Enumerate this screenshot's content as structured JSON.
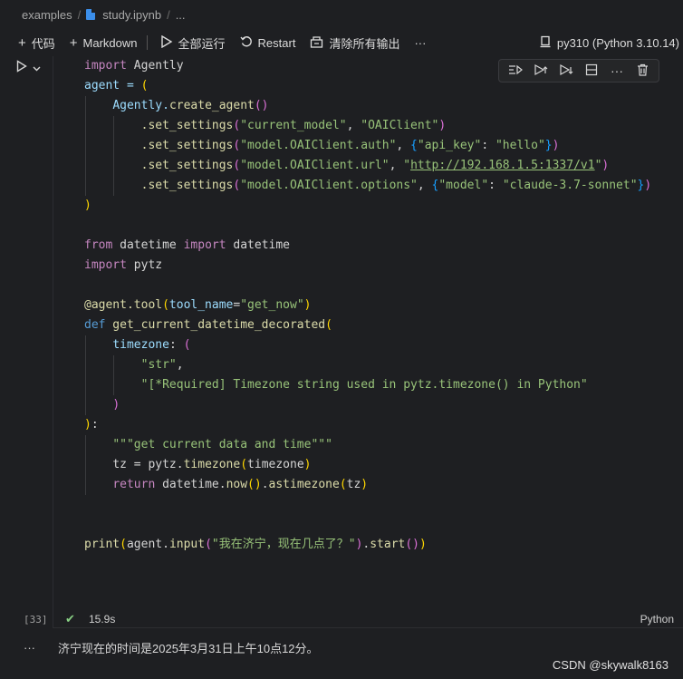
{
  "breadcrumb": {
    "folder": "examples",
    "file": "study.ipynb",
    "more": "..."
  },
  "toolbar": {
    "code": "代码",
    "markdown": "Markdown",
    "run_all": "全部运行",
    "restart": "Restart",
    "clear_outputs": "清除所有输出",
    "more": "···",
    "kernel": "py310 (Python 3.10.14)"
  },
  "cell": {
    "execution_count": "[33]",
    "duration": "15.9s",
    "language": "Python",
    "output": "济宁现在的时间是2025年3月31日上午10点12分。",
    "output_dots": "···"
  },
  "code": {
    "l1a": "import",
    "l1b": " Agently",
    "l2a": "agent = ",
    "l2b": "(",
    "l3a": "Agently.",
    "l3b": "create_agent",
    "l3c": "()",
    "l4a": ".set_settings",
    "l4b": "(",
    "l4c": "\"current_model\"",
    "l4d": ", ",
    "l4e": "\"OAIClient\"",
    "l4f": ")",
    "l5a": ".set_settings",
    "l5b": "(",
    "l5c": "\"model.OAIClient.auth\"",
    "l5d": ", ",
    "l5e": "{",
    "l5f": "\"api_key\"",
    "l5g": ": ",
    "l5h": "\"hello\"",
    "l5i": "}",
    "l5j": ")",
    "l6a": ".set_settings",
    "l6b": "(",
    "l6c": "\"model.OAIClient.url\"",
    "l6d": ", ",
    "l6e": "\"",
    "l6f": "http://192.168.1.5:1337/v1",
    "l6g": "\"",
    "l6h": ")",
    "l7a": ".set_settings",
    "l7b": "(",
    "l7c": "\"model.OAIClient.options\"",
    "l7d": ", ",
    "l7e": "{",
    "l7f": "\"model\"",
    "l7g": ": ",
    "l7h": "\"claude-3.7-sonnet\"",
    "l7i": "}",
    "l7j": ")",
    "l8": ")",
    "l10a": "from",
    "l10b": " datetime ",
    "l10c": "import",
    "l10d": " datetime",
    "l11a": "import",
    "l11b": " pytz",
    "l13a": "@agent.tool",
    "l13b": "(",
    "l13c": "tool_name",
    "l13d": "=",
    "l13e": "\"get_now\"",
    "l13f": ")",
    "l14a": "def",
    "l14b": " get_current_datetime_decorated",
    "l14c": "(",
    "l15a": "timezone",
    "l15b": ": ",
    "l15c": "(",
    "l16a": "\"str\"",
    "l16b": ",",
    "l17": "\"[*Required] Timezone string used in pytz.timezone() in Python\"",
    "l18": ")",
    "l19a": ")",
    "l19b": ":",
    "l20": "\"\"\"get current data and time\"\"\"",
    "l21a": "tz = pytz.",
    "l21b": "timezone",
    "l21c": "(",
    "l21d": "timezone",
    "l21e": ")",
    "l22a": "return",
    "l22b": " datetime.",
    "l22c": "now",
    "l22d": "()",
    "l22e": ".",
    "l22f": "astimezone",
    "l22g": "(",
    "l22h": "tz",
    "l22i": ")",
    "l25a": "print",
    "l25b": "(",
    "l25c": "agent.",
    "l25d": "input",
    "l25e": "(",
    "l25f": "\"我在济宁，现在几点了？\"",
    "l25g": ")",
    "l25h": ".",
    "l25i": "start",
    "l25j": "()",
    "l25k": ")"
  },
  "watermark": "CSDN @skywalk8163"
}
